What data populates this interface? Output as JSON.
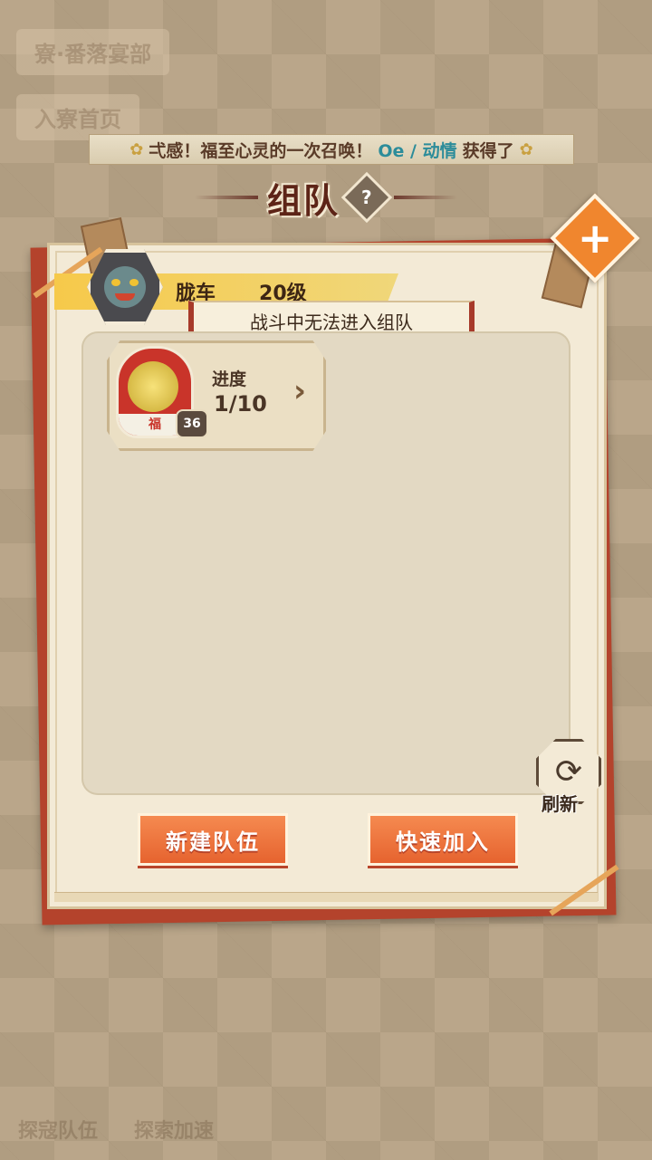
{
  "background": {
    "ghost_top_tab": "寮·番落宴部",
    "ghost_second_tab": "入寮首页",
    "ghost_bottom_left": "探寇队伍",
    "ghost_bottom_mid": "探索加速"
  },
  "marquee": {
    "prefix": "弌感！福至心灵的一次召唤！",
    "player": "Oe / 动情",
    "suffix": "获得了"
  },
  "header": {
    "title": "组队",
    "help": "?"
  },
  "close": {
    "icon": "close-icon",
    "label": "+"
  },
  "player": {
    "name": "胧车",
    "level": "20级"
  },
  "notice": "战斗中无法进入组队",
  "cards": [
    {
      "art_label": "福",
      "badge": "36",
      "progress_label": "进度",
      "progress_value": "1/10"
    }
  ],
  "refresh_label": "刷新",
  "buttons": {
    "create": "新建队伍",
    "quick_join": "快速加入"
  },
  "colors": {
    "accent": "#e6632f",
    "panel_frame": "#b4432c",
    "highlight_name": "#2c8c9a"
  }
}
